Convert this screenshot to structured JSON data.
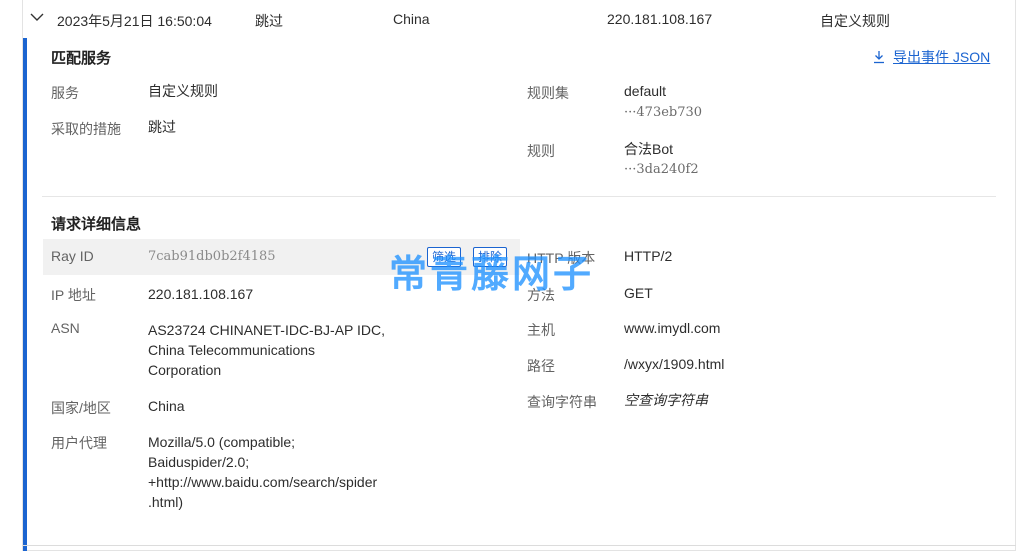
{
  "event": {
    "datetime": "2023年5月21日 16:50:04",
    "action": "跳过",
    "country": "China",
    "ip": "220.181.108.167",
    "service": "自定义规则"
  },
  "matched": {
    "title": "匹配服务",
    "export_label": "导出事件 JSON",
    "service_label": "服务",
    "service_value": "自定义规则",
    "action_label": "采取的措施",
    "action_value": "跳过",
    "ruleset_label": "规则集",
    "ruleset_name": "default",
    "ruleset_id": "···473eb730",
    "rule_label": "规则",
    "rule_name": "合法Bot",
    "rule_id": "···3da240f2"
  },
  "request": {
    "title": "请求详细信息",
    "ray_label": "Ray ID",
    "ray_value": "7cab91db0b2f4185",
    "filter_btn": "筛选",
    "exclude_btn": "排除",
    "ip_label": "IP 地址",
    "ip_value": "220.181.108.167",
    "asn_label": "ASN",
    "asn_value_lines": [
      "AS23724 CHINANET-IDC-BJ-AP IDC,",
      "China Telecommunications",
      "Corporation"
    ],
    "country_label": "国家/地区",
    "country_value": "China",
    "ua_label": "用户代理",
    "ua_value_lines": [
      "Mozilla/5.0 (compatible;",
      "Baiduspider/2.0;",
      "+http://www.baidu.com/search/spider",
      ".html)"
    ],
    "http_label": "HTTP 版本",
    "http_value": "HTTP/2",
    "method_label": "方法",
    "method_value": "GET",
    "host_label": "主机",
    "host_value": "www.imydl.com",
    "path_label": "路径",
    "path_value": "/wxyx/1909.html",
    "query_label": "查询字符串",
    "query_value": "空查询字符串"
  },
  "watermark": "常青藤网子",
  "colors": {
    "accent": "#1b64d0",
    "watermark": "#2092ff"
  },
  "icons": {
    "expand": "chevron-down-icon",
    "download": "download-icon"
  }
}
